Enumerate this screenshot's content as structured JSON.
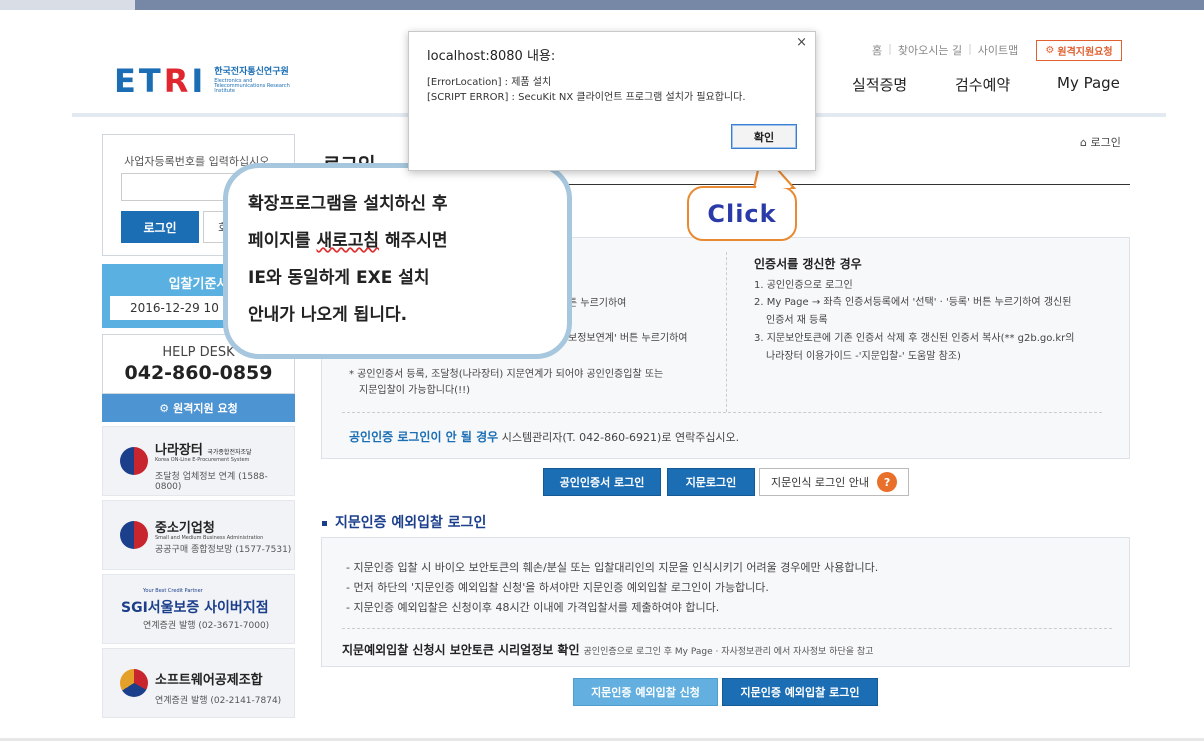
{
  "header": {
    "logo_mark_blue": "ET",
    "logo_mark_red": "R",
    "logo_mark_blue2": "I",
    "logo_ko": "한국전자통신연구원",
    "logo_en": "Electronics and Telecommunications Research Institute",
    "util_links": [
      "홈",
      "찾아오시는 길",
      "사이트맵"
    ],
    "remote_support": "원격지원요청",
    "gnb": [
      "실적증명",
      "검수예약",
      "My Page"
    ]
  },
  "breadcrumb": "로그인",
  "sidebar": {
    "login_hint": "사업자등록번호를 입력하십시오.",
    "login_button": "로그인",
    "register_button": "회",
    "bid_title": "입찰기준시",
    "bid_date": "2016-12-29 10 3",
    "help_title": "HELP DESK",
    "help_phone": "042-860-0859",
    "help_remote": "원격지원 요청",
    "partners": [
      {
        "name": "나라장터",
        "name_sub": "국가종합전자조달",
        "en": "Korea ON-Line E-Procurement System",
        "desc": "조달청 업체정보 연계 (1588-0800)"
      },
      {
        "name": "중소기업청",
        "en": "Small and Medium Business Administration",
        "desc": "공공구매 종합정보망 (1577-7531)"
      },
      {
        "name": "SGI서울보증 사이버지점",
        "en": "Your Best Credit Partner",
        "desc": "연계증권 발행 (02-3671-7000)"
      },
      {
        "name": "소프트웨어공제조합",
        "desc": "연계증권 발행 (02-2141-7874)"
      }
    ]
  },
  "main": {
    "title": "로그인",
    "cert_left_lines": [
      "튼 누르기하여",
      "보정보연계' 버튼 누르기하여"
    ],
    "cert_note": [
      "* 공인인증서 등록, 조달청(나라장터) 지문연계가 되어야 공인인증입찰 또는",
      "지문입찰이 가능합니다(!!)"
    ],
    "cert_renew_title": "인증서를 갱신한 경우",
    "cert_renew_lines": [
      "1. 공인인증으로 로그인",
      "2. My Page → 좌측 인증서등록에서 '선택'    · '등록' 버튼 누르기하여 갱신된",
      "인증서 재 등록",
      "3. 지문보안토큰에 기존 인증서 삭제 후 갱신된 인증서 복사(** g2b.go.kr의",
      "나라장터 이용가이드 -'지문입찰-' 도움말 참조)"
    ],
    "cert_footer_bold": "공인인증 로그인이 안 될 경우",
    "cert_footer_rest": "시스템관리자(T. 042-860-6921)로 연락주십시오.",
    "buttons": {
      "cert_login": "공인인증서 로그인",
      "fp_login": "지문로그인",
      "fp_guide": "지문인식 로그인 안내",
      "fp_guide_icon": "?"
    },
    "exception_title": "지문인증 예외입찰 로그인",
    "exception_lines": [
      "- 지문인증 입찰 시 바이오 보안토큰의 훼손/분실 또는 입찰대리인의 지문을 인식시키기 어려울 경우에만 사용합니다.",
      "- 먼저 하단의 '지문인증 예외입찰 신청'을 하셔야만 지문인증 예외입찰 로그인이 가능합니다.",
      "- 지문인증 예외입찰은 신청이후 48시간 이내에 가격입찰서를 제출하여야 합니다."
    ],
    "exception_foot_bold": "지문예외입찰 신청시 보안토큰 시리얼정보 확인",
    "exception_foot_rest": "공인인증으로 로그인 후 My Page     · 자사정보관리 에서 자사정보 하단을 참고",
    "exception_apply": "지문인증 예외입찰 신청",
    "exception_login": "지문인증 예외입찰 로그인"
  },
  "dialog": {
    "title": "localhost:8080 내용:",
    "close": "×",
    "line1": "[ErrorLocation] : 제품 설치",
    "line2": "[SCRIPT ERROR] :  SecuKit NX 클라이언트 프로그램 설치가 필요합니다.",
    "ok": "확인"
  },
  "callout": {
    "line1": "확장프로그램을 설치하신 후",
    "line2_pre": "페이지를 ",
    "line2_u": "새로고침",
    "line2_post": " 해주시면",
    "line3": "IE와 동일하게 EXE 설치",
    "line4": "안내가 나오게 됩니다."
  },
  "click_label": "Click",
  "colors": {
    "primary": "#1b6eb4",
    "accent": "#e8702a",
    "callout_border": "#a6c7de"
  }
}
